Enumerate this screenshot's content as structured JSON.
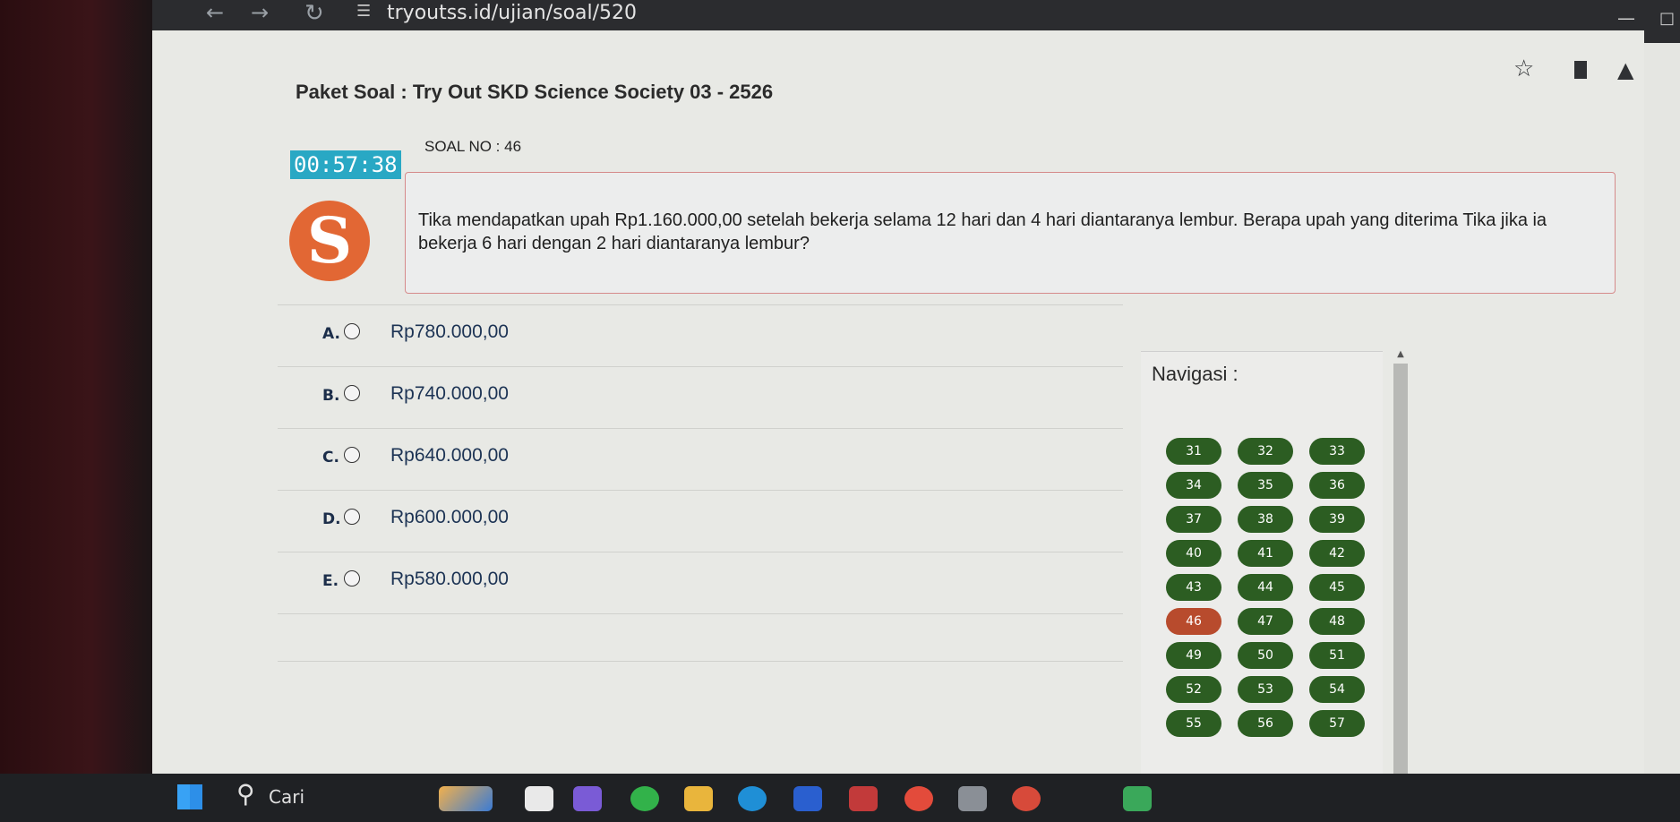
{
  "browser": {
    "url": "tryoutss.id/ujian/soal/520",
    "back_icon": "arrow-left-icon",
    "forward_icon": "arrow-right-icon",
    "reload_icon": "reload-icon",
    "site_icon": "site-settings-icon"
  },
  "page": {
    "title": "Paket Soal : Try Out SKD Science Society 03 - 2526",
    "timer": "00:57:38",
    "logo_letter": "S",
    "soal_label": "SOAL NO : 46",
    "question": "Tika mendapatkan upah Rp1.160.000,00 setelah bekerja selama 12 hari dan 4 hari diantaranya lembur. Berapa upah yang diterima Tika jika ia bekerja 6 hari dengan 2 hari diantaranya lembur?",
    "options": [
      {
        "letter": "A.",
        "text": "Rp780.000,00"
      },
      {
        "letter": "B.",
        "text": "Rp740.000,00"
      },
      {
        "letter": "C.",
        "text": "Rp640.000,00"
      },
      {
        "letter": "D.",
        "text": "Rp600.000,00"
      },
      {
        "letter": "E.",
        "text": "Rp580.000,00"
      }
    ]
  },
  "navigation": {
    "title": "Navigasi :",
    "current": "46",
    "numbers": [
      "31",
      "32",
      "33",
      "34",
      "35",
      "36",
      "37",
      "38",
      "39",
      "40",
      "41",
      "42",
      "43",
      "44",
      "45",
      "46",
      "47",
      "48",
      "49",
      "50",
      "51",
      "52",
      "53",
      "54",
      "55",
      "56",
      "57"
    ]
  },
  "taskbar": {
    "search_label": "Cari"
  },
  "colors": {
    "timer_bg": "#29a8c4",
    "logo_bg": "#e26734",
    "nav_done": "#2c5d22",
    "nav_current": "#b84b2d"
  }
}
